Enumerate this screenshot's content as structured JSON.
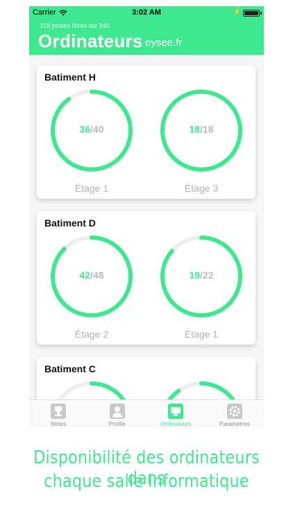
{
  "status_bar": {
    "carrier": "Carrier",
    "time": "3:02 AM"
  },
  "header": {
    "subtitle": "318 postes libres sur 340",
    "title": "Ordinateurs",
    "site": "eysee.fr"
  },
  "buildings": [
    {
      "name": "Batiment H",
      "floors": [
        {
          "label": "Étage 1",
          "free": "36",
          "total": "/40"
        },
        {
          "label": "Étage 3",
          "free": "18",
          "total": "/18"
        }
      ]
    },
    {
      "name": "Batiment D",
      "floors": [
        {
          "label": "Étage 2",
          "free": "42",
          "total": "/48"
        },
        {
          "label": "Étage 1",
          "free": "19",
          "total": "/22"
        }
      ]
    },
    {
      "name": "Batiment C",
      "floors": [
        {
          "label": "",
          "free": "",
          "total": ""
        },
        {
          "label": "",
          "free": "",
          "total": ""
        }
      ]
    }
  ],
  "tabs": [
    {
      "label": "Notes",
      "icon": "trophy-icon"
    },
    {
      "label": "Profile",
      "icon": "person-icon"
    },
    {
      "label": "Ordinateurs",
      "icon": "monitor-icon"
    },
    {
      "label": "Paramètres",
      "icon": "gear-icon"
    }
  ],
  "active_tab": "Ordinateurs",
  "caption": {
    "line1": "Disponibilité des ordinateurs dans",
    "line2": "chaque salle informatique"
  },
  "colors": {
    "accent": "#3ee88e",
    "track": "#eeeeee",
    "muted": "#bbbbbb"
  }
}
